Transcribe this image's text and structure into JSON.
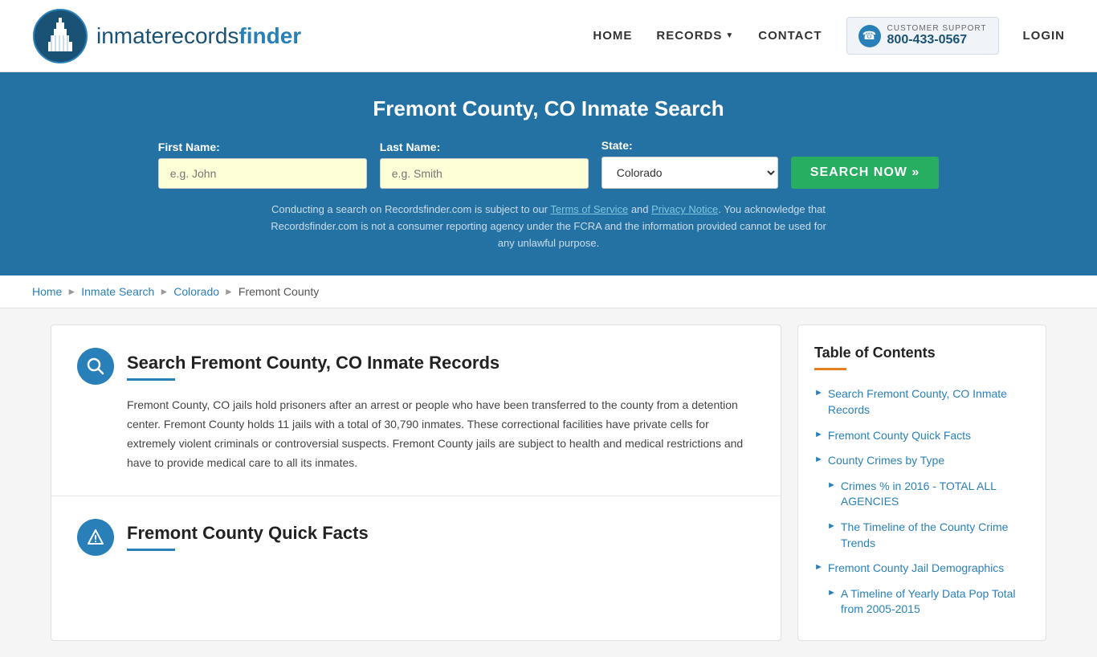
{
  "header": {
    "logo_text_part1": "inmaterecords",
    "logo_text_part2": "finder",
    "nav": {
      "home": "HOME",
      "records": "RECORDS",
      "contact": "CONTACT",
      "login": "LOGIN"
    },
    "support": {
      "label": "CUSTOMER SUPPORT",
      "phone": "800-433-0567"
    }
  },
  "hero": {
    "title": "Fremont County, CO Inmate Search",
    "first_name_label": "First Name:",
    "first_name_placeholder": "e.g. John",
    "last_name_label": "Last Name:",
    "last_name_placeholder": "e.g. Smith",
    "state_label": "State:",
    "state_value": "Colorado",
    "search_button": "SEARCH NOW »",
    "disclaimer": "Conducting a search on Recordsfinder.com is subject to our Terms of Service and Privacy Notice. You acknowledge that Recordsfinder.com is not a consumer reporting agency under the FCRA and the information provided cannot be used for any unlawful purpose."
  },
  "breadcrumb": {
    "items": [
      "Home",
      "Inmate Search",
      "Colorado",
      "Fremont County"
    ]
  },
  "content": {
    "section1": {
      "title": "Search Fremont County, CO Inmate Records",
      "body": "Fremont County, CO jails hold prisoners after an arrest or people who have been transferred to the county from a detention center. Fremont County holds 11 jails with a total of 30,790 inmates. These correctional facilities have private cells for extremely violent criminals or controversial suspects. Fremont County jails are subject to health and medical restrictions and have to provide medical care to all its inmates."
    },
    "section2": {
      "title": "Fremont County Quick Facts"
    }
  },
  "toc": {
    "title": "Table of Contents",
    "items": [
      {
        "label": "Search Fremont County, CO Inmate Records",
        "sub": false
      },
      {
        "label": "Fremont County Quick Facts",
        "sub": false
      },
      {
        "label": "County Crimes by Type",
        "sub": false
      },
      {
        "label": "Crimes % in 2016 - TOTAL ALL AGENCIES",
        "sub": true
      },
      {
        "label": "The Timeline of the County Crime Trends",
        "sub": true
      },
      {
        "label": "Fremont County Jail Demographics",
        "sub": false
      },
      {
        "label": "A Timeline of Yearly Data Pop Total from 2005-2015",
        "sub": true
      }
    ]
  }
}
